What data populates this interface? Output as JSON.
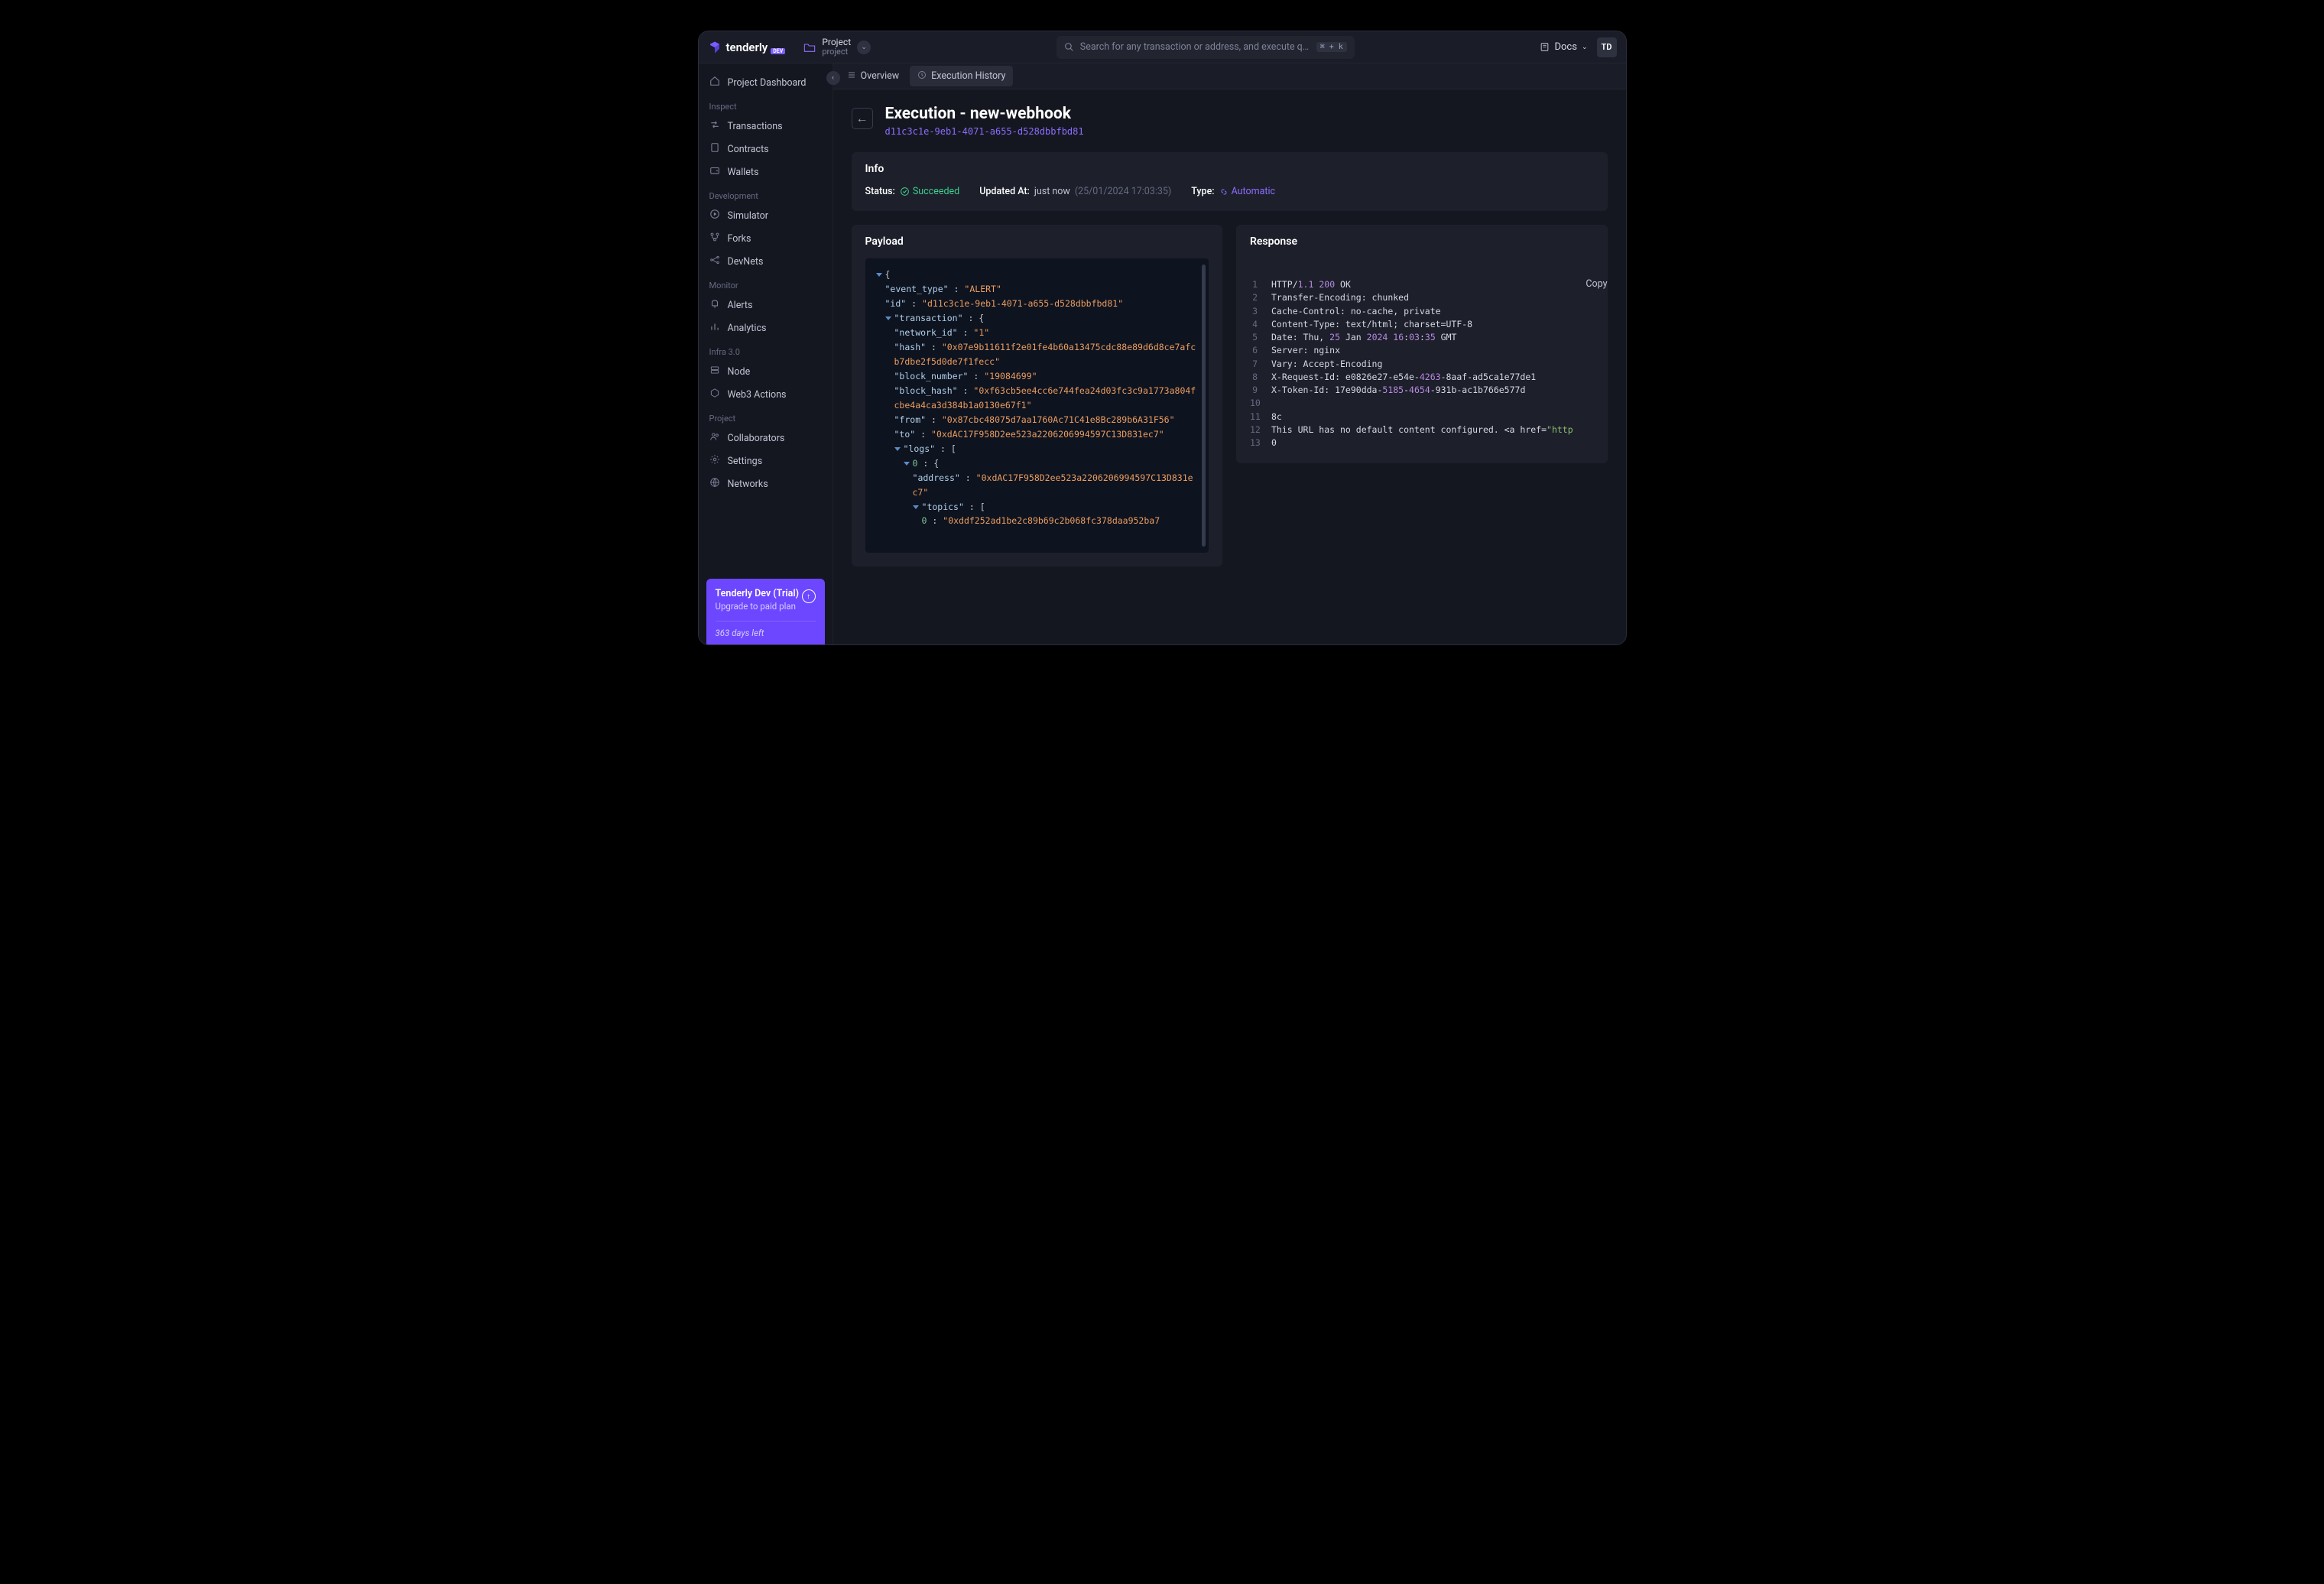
{
  "brand": {
    "name": "tenderly",
    "badge": "DEV"
  },
  "project": {
    "name": "Project",
    "sub": "project"
  },
  "search": {
    "placeholder": "Search for any transaction or address, and execute quick c...",
    "kbd": "⌘ + k"
  },
  "topright": {
    "docs": "Docs",
    "avatar": "TD"
  },
  "sidebar": {
    "dashboard": "Project Dashboard",
    "inspect_head": "Inspect",
    "transactions": "Transactions",
    "contracts": "Contracts",
    "wallets": "Wallets",
    "dev_head": "Development",
    "simulator": "Simulator",
    "forks": "Forks",
    "devnets": "DevNets",
    "monitor_head": "Monitor",
    "alerts": "Alerts",
    "analytics": "Analytics",
    "infra_head": "Infra 3.0",
    "node": "Node",
    "web3actions": "Web3 Actions",
    "project_head": "Project",
    "collaborators": "Collaborators",
    "settings": "Settings",
    "networks": "Networks"
  },
  "upgrade": {
    "title": "Tenderly Dev (Trial)",
    "sub": "Upgrade to paid plan",
    "days": "363 days left"
  },
  "tabs": {
    "overview": "Overview",
    "history": "Execution History"
  },
  "page": {
    "title": "Execution - new-webhook",
    "id": "d11c3c1e-9eb1-4071-a655-d528dbbfbd81"
  },
  "info": {
    "head": "Info",
    "status_label": "Status:",
    "status_value": "Succeeded",
    "updated_label": "Updated At:",
    "updated_value": "just now",
    "updated_ts": "(25/01/2024 17:03:35)",
    "type_label": "Type:",
    "type_value": "Automatic"
  },
  "payload": {
    "head": "Payload",
    "json": {
      "event_type": "ALERT",
      "id": "d11c3c1e-9eb1-4071-a655-d528dbbfbd81",
      "transaction": {
        "network_id": "1",
        "hash": "0x07e9b11611f2e01fe4b60a13475cdc88e89d6d8ce7afcb7dbe2f5d0de7f1fecc",
        "block_number": "19084699",
        "block_hash": "0xf63cb5ee4cc6e744fea24d03fc3c9a1773a804fcbe4a4ca3d384b1a0130e67f1",
        "from": "0x87cbc48075d7aa1760Ac71C41e8Bc289b6A31F56",
        "to": "0xdAC17F958D2ee523a2206206994597C13D831ec7",
        "logs": {
          "index0_label": "0",
          "address_label": "address",
          "address": "0xdAC17F958D2ee523a2206206994597C13D831ec7",
          "topics_label": "topics",
          "topic0_label": "0",
          "topic0": "0xddf252ad1be2c89b69c2b068fc378daa952ba7"
        }
      }
    }
  },
  "response": {
    "head": "Response",
    "copy": "Copy",
    "lines": {
      "l1_a": "HTTP/",
      "l1_b": "1.1",
      "l1_c": " ",
      "l1_d": "200",
      "l1_e": " OK",
      "l2": "Transfer-Encoding: chunked",
      "l3": "Cache-Control: no-cache, private",
      "l4": "Content-Type: text/html; charset=UTF-8",
      "l5_a": "Date: Thu, ",
      "l5_b": "25",
      "l5_c": " Jan ",
      "l5_d": "2024",
      "l5_e": " ",
      "l5_f": "16",
      "l5_g": ":",
      "l5_h": "03",
      "l5_i": ":",
      "l5_j": "35",
      "l5_k": " GMT",
      "l6": "Server: nginx",
      "l7": "Vary: Accept-Encoding",
      "l8_a": "X-Request-Id: e0826e27-e54e-",
      "l8_b": "4263",
      "l8_c": "-8aaf-ad5ca1e77de1",
      "l9_a": "X-Token-Id: 17e90dda-",
      "l9_b": "5185",
      "l9_c": "-",
      "l9_d": "4654",
      "l9_e": "-931b-ac1b766e577d",
      "l10": "",
      "l11": "8c",
      "l12_a": "This URL has no default content configured. <a href=",
      "l12_b": "\"http",
      "l13": "0"
    }
  }
}
